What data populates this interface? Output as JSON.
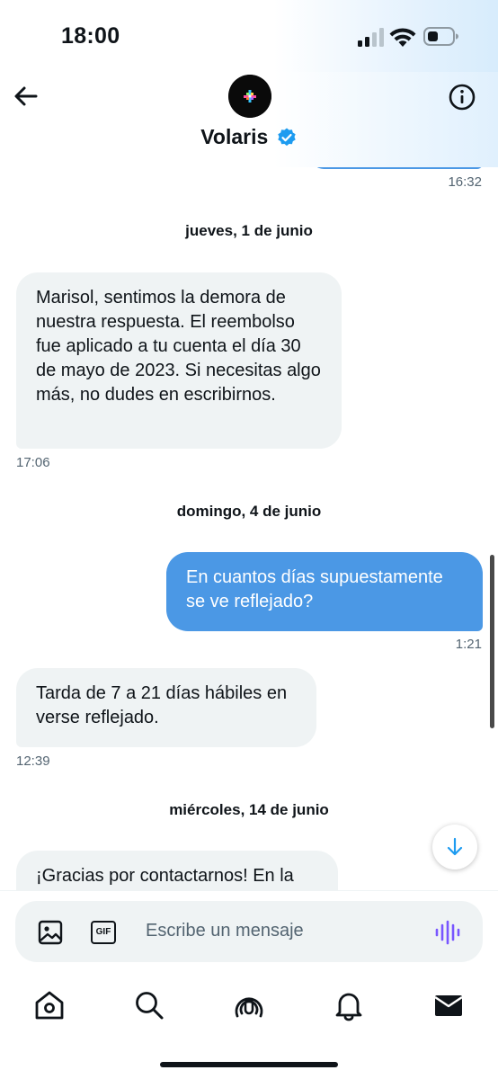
{
  "status_bar": {
    "time": "18:00",
    "icons": [
      "cellular-signal-icon",
      "wifi-icon",
      "battery-icon"
    ]
  },
  "header": {
    "title": "Volaris",
    "verified": true,
    "back_icon": "back-arrow-icon",
    "info_icon": "info-icon"
  },
  "messages": [
    {
      "type": "timestamp",
      "side": "right",
      "time": "16:32"
    },
    {
      "type": "date",
      "label": "jueves, 1 de junio"
    },
    {
      "type": "incoming",
      "text": "Marisol, sentimos la demora de nuestra respuesta. El reembolso fue aplicado a tu cuenta el día 30 de mayo de 2023. Si necesitas algo más, no dudes en escribirnos.",
      "time": "17:06"
    },
    {
      "type": "date",
      "label": "domingo, 4 de junio"
    },
    {
      "type": "outgoing",
      "text": "En cuantos días supuestamente se ve reflejado?",
      "time": "1:21"
    },
    {
      "type": "incoming",
      "text": "Tarda de 7 a 21 días hábiles en verse reflejado.",
      "time": "12:39"
    },
    {
      "type": "date",
      "label": "miércoles, 14 de junio"
    },
    {
      "type": "incoming",
      "text": "¡Gracias por contactarnos! En la"
    }
  ],
  "composer": {
    "placeholder": "Escribe un mensaje",
    "image_icon": "image-icon",
    "gif_label": "GIF",
    "voice_icon": "voice-waveform-icon"
  },
  "tabbar": [
    "home-icon",
    "search-icon",
    "spaces-icon",
    "notifications-icon",
    "messages-icon"
  ],
  "colors": {
    "accent": "#1d9bf0",
    "outgoing_bubble": "#4b98e5",
    "incoming_bubble": "#eff3f4",
    "voice": "#7856ff"
  }
}
